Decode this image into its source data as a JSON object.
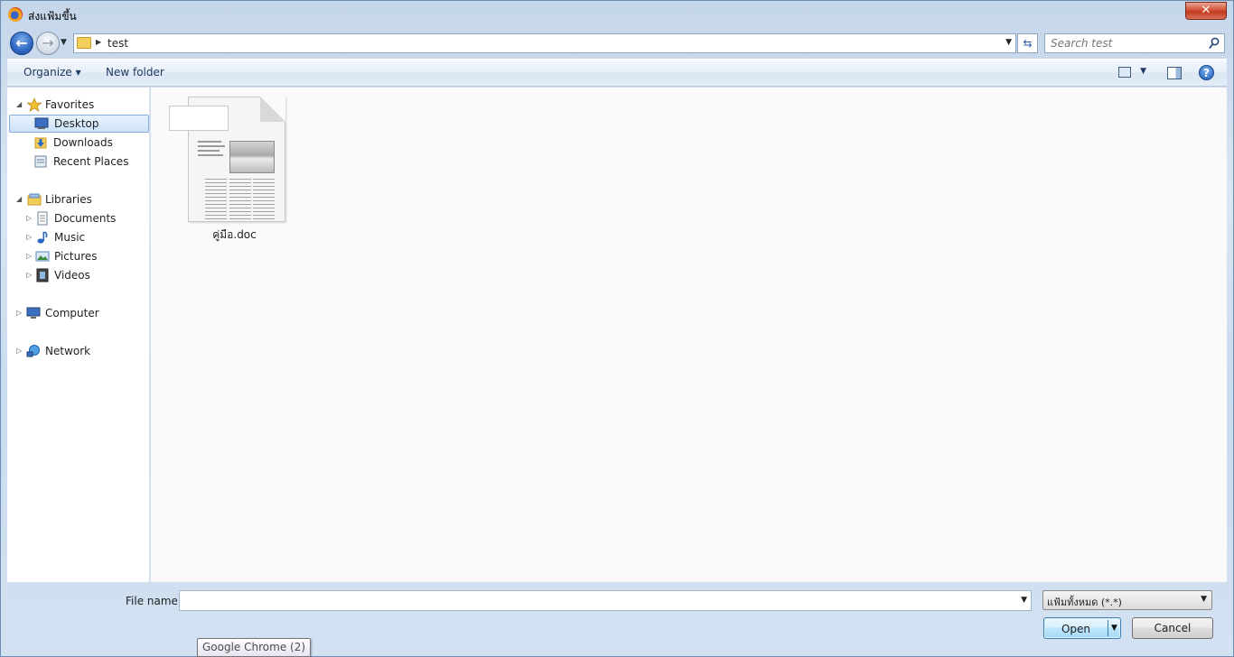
{
  "window": {
    "title": "ส่งแฟ้มขึ้น",
    "close_label": "✕"
  },
  "nav": {
    "back_icon": "back-arrow-icon",
    "forward_icon": "forward-arrow-icon",
    "breadcrumb": [
      "test"
    ],
    "search_placeholder": "Search test"
  },
  "toolbar": {
    "organize_label": "Organize ▾",
    "new_folder_label": "New folder",
    "help_label": "?"
  },
  "sidebar": {
    "groups": [
      {
        "label": "Favorites",
        "icon": "star-icon"
      },
      {
        "label": "Libraries",
        "icon": "libraries-icon"
      },
      {
        "label": "Computer",
        "icon": "computer-icon"
      },
      {
        "label": "Network",
        "icon": "network-icon"
      }
    ],
    "favorites": [
      {
        "label": "Desktop",
        "icon": "desktop-icon",
        "selected": true
      },
      {
        "label": "Downloads",
        "icon": "downloads-folder-icon"
      },
      {
        "label": "Recent Places",
        "icon": "recent-places-icon"
      }
    ],
    "libraries": [
      {
        "label": "Documents",
        "icon": "documents-icon"
      },
      {
        "label": "Music",
        "icon": "music-icon"
      },
      {
        "label": "Pictures",
        "icon": "pictures-icon"
      },
      {
        "label": "Videos",
        "icon": "videos-icon"
      }
    ]
  },
  "files": [
    {
      "name": "คู่มือ.doc",
      "icon": "word-document-icon"
    }
  ],
  "footer": {
    "file_name_label": "File name:",
    "file_name_value": "",
    "filter_value": "แฟ้มทั้งหมด (*.*)",
    "open_label": "Open",
    "cancel_label": "Cancel"
  },
  "tooltip": {
    "text": "Google Chrome (2)"
  },
  "colors": {
    "accent": "#2d67c4",
    "selection": "#cde3fb",
    "close": "#c23a1e"
  }
}
